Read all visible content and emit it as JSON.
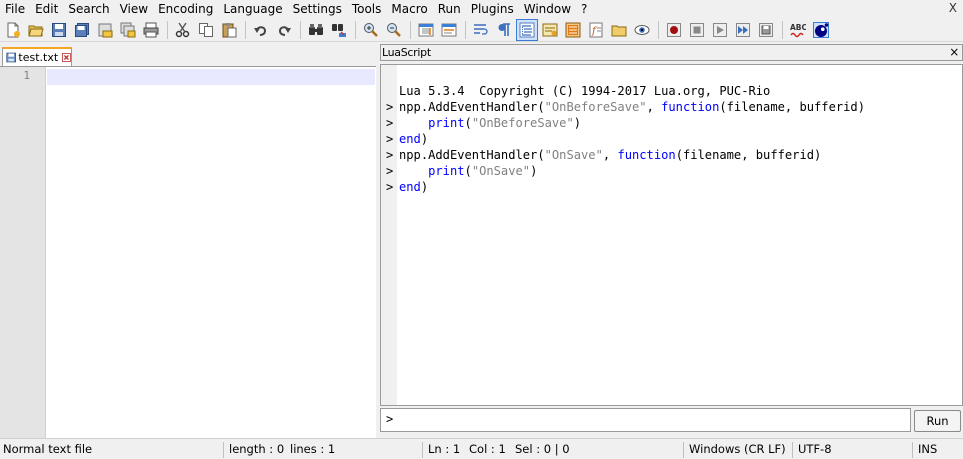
{
  "menubar": {
    "items": [
      "File",
      "Edit",
      "Search",
      "View",
      "Encoding",
      "Language",
      "Settings",
      "Tools",
      "Macro",
      "Run",
      "Plugins",
      "Window",
      "?"
    ],
    "close_label": "X"
  },
  "toolbar": {
    "icons": [
      "new-file-icon",
      "open-file-icon",
      "save-icon",
      "save-all-icon",
      "close-icon",
      "close-all-icon",
      "print-icon",
      "cut-icon",
      "copy-icon",
      "paste-icon",
      "undo-icon",
      "redo-icon",
      "find-icon",
      "replace-icon",
      "zoom-in-icon",
      "zoom-out-icon",
      "sync-vertical-icon",
      "sync-horizontal-icon",
      "word-wrap-icon",
      "show-all-chars-icon",
      "indent-guide-icon",
      "user-define-language-icon",
      "document-map-icon",
      "function-list-icon",
      "folder-workspace-icon",
      "monitoring-icon",
      "record-macro-icon",
      "stop-macro-icon",
      "play-macro-icon",
      "run-macro-multiple-icon",
      "save-macro-icon",
      "spell-check-icon",
      "luascript-icon"
    ],
    "active_icon": "indent-guide-icon"
  },
  "editor": {
    "tab_label": "test.txt",
    "line_numbers": [
      "1"
    ]
  },
  "luascript": {
    "title": "LuaScript",
    "close_label": "×",
    "banner": "Lua 5.3.4  Copyright (C) 1994-2017 Lua.org, PUC-Rio",
    "prompt": ">",
    "lines": [
      {
        "prompt": ">",
        "parts": [
          [
            "plain2",
            "npp.AddEventHandler("
          ],
          [
            "str",
            "\"OnBeforeSave\""
          ],
          [
            "plain2",
            ", "
          ],
          [
            "kw",
            "function"
          ],
          [
            "plain2",
            "(filename, bufferid)"
          ]
        ]
      },
      {
        "prompt": ">",
        "parts": [
          [
            "plain2",
            "    "
          ],
          [
            "kw",
            "print"
          ],
          [
            "plain2",
            "("
          ],
          [
            "str",
            "\"OnBeforeSave\""
          ],
          [
            "plain2",
            ")"
          ]
        ]
      },
      {
        "prompt": ">",
        "parts": [
          [
            "kw",
            "end"
          ],
          [
            "plain2",
            ")"
          ]
        ]
      },
      {
        "prompt": ">",
        "parts": [
          [
            "plain2",
            "npp.AddEventHandler("
          ],
          [
            "str",
            "\"OnSave\""
          ],
          [
            "plain2",
            ", "
          ],
          [
            "kw",
            "function"
          ],
          [
            "plain2",
            "(filename, bufferid)"
          ]
        ]
      },
      {
        "prompt": ">",
        "parts": [
          [
            "plain2",
            "    "
          ],
          [
            "kw",
            "print"
          ],
          [
            "plain2",
            "("
          ],
          [
            "str",
            "\"OnSave\""
          ],
          [
            "plain2",
            ")"
          ]
        ]
      },
      {
        "prompt": ">",
        "parts": [
          [
            "kw",
            "end"
          ],
          [
            "plain2",
            ")"
          ]
        ]
      }
    ],
    "input_prompt": ">",
    "input_value": "",
    "run_label": "Run"
  },
  "statusbar": {
    "file_type": "Normal text file",
    "length": "length : 0",
    "lines": "lines : 1",
    "ln": "Ln : 1",
    "col": "Col : 1",
    "sel": "Sel : 0 | 0",
    "eol": "Windows (CR LF)",
    "encoding": "UTF-8",
    "mode": "INS"
  }
}
